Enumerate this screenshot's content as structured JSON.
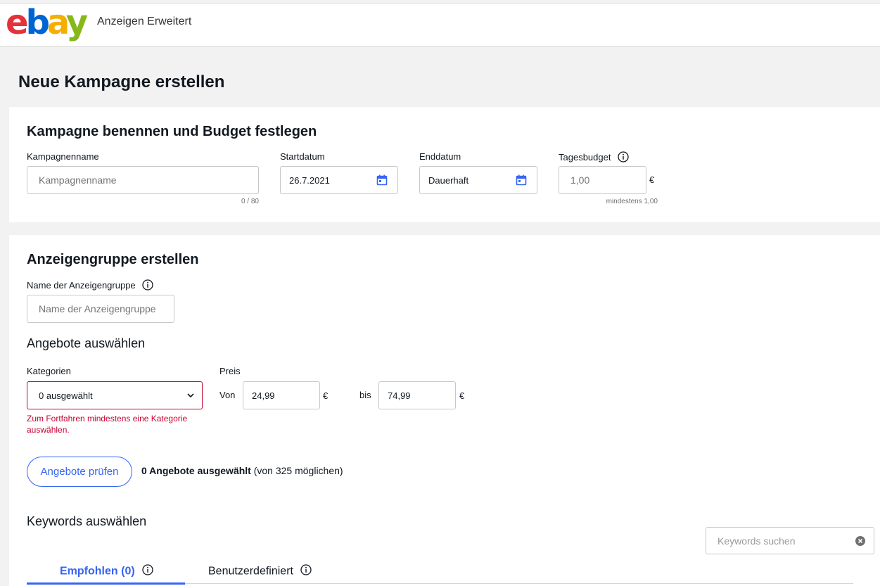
{
  "header": {
    "logo_text": "ebay",
    "app_title": "Anzeigen Erweitert"
  },
  "page": {
    "title": "Neue Kampagne erstellen"
  },
  "campaign": {
    "heading": "Kampagne benennen und Budget festlegen",
    "name_label": "Kampagnenname",
    "name_placeholder": "Kampagnenname",
    "name_counter": "0 / 80",
    "start_label": "Startdatum",
    "start_value": "26.7.2021",
    "end_label": "Enddatum",
    "end_value": "Dauerhaft",
    "budget_label": "Tagesbudget",
    "budget_placeholder": "1,00",
    "budget_currency": "€",
    "budget_hint": "mindestens 1,00"
  },
  "adgroup": {
    "heading": "Anzeigengruppe erstellen",
    "name_label": "Name der Anzeigengruppe",
    "name_placeholder": "Name der Anzeigengruppe",
    "offers_heading": "Angebote auswählen",
    "categories_label": "Kategorien",
    "categories_value": "0 ausgewählt",
    "categories_error": "Zum Fortfahren mindestens eine Kategorie auswählen.",
    "price_label": "Preis",
    "from_label": "Von",
    "from_value": "24,99",
    "from_currency": "€",
    "to_label": "bis",
    "to_value": "74,99",
    "to_currency": "€",
    "check_offers_button": "Angebote prüfen",
    "selected_count_bold": "0 Angebote ausgewählt",
    "selected_count_rest": " (von 325 möglichen)"
  },
  "keywords": {
    "heading": "Keywords auswählen",
    "search_placeholder": "Keywords suchen",
    "tabs": [
      {
        "label": "Empfohlen (0)",
        "active": true
      },
      {
        "label": "Benutzerdefiniert",
        "active": false
      }
    ]
  },
  "colors": {
    "accent": "#3665f3",
    "error": "#c6002f"
  }
}
